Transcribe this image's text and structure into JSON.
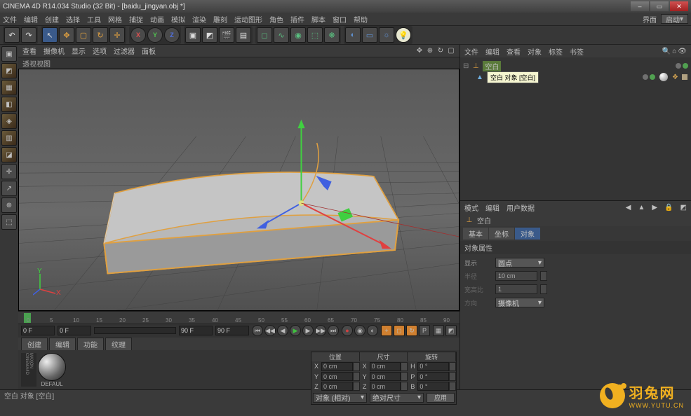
{
  "title": "CINEMA 4D R14.034 Studio (32 Bit) - [baidu_jingyan.obj *]",
  "menu": [
    "文件",
    "编辑",
    "创建",
    "选择",
    "工具",
    "网格",
    "捕捉",
    "动画",
    "模拟",
    "渲染",
    "雕刻",
    "运动图形",
    "角色",
    "插件",
    "脚本",
    "窗口",
    "帮助"
  ],
  "right_menu": {
    "label1": "界面",
    "layout_btn": "启动"
  },
  "toolbar_undo": [
    "↶",
    "↷"
  ],
  "toolbar_select": [
    "▦",
    "✥",
    "▢",
    "↻",
    "✛"
  ],
  "axis": [
    "X",
    "Y",
    "Z"
  ],
  "viewport_menu": [
    "查看",
    "摄像机",
    "显示",
    "选项",
    "过滤器",
    "面板"
  ],
  "viewport_sub": "透视视图",
  "left_icons": [
    "◩",
    "▦",
    "◧",
    "◈",
    "◩",
    "▥",
    "◪",
    "◊",
    "↗",
    "⊕",
    "⬚"
  ],
  "timeline": {
    "start": "0 F",
    "cur": "0 F",
    "end2": "90 F",
    "end": "90 F",
    "ticks": [
      0,
      5,
      10,
      15,
      20,
      25,
      30,
      35,
      40,
      45,
      50,
      55,
      60,
      65,
      70,
      75,
      80,
      85,
      90
    ]
  },
  "material_tabs": [
    "创建",
    "编辑",
    "功能",
    "纹理"
  ],
  "mat_default": "DEFAUL",
  "obj_header": [
    "文件",
    "编辑",
    "查看",
    "对象",
    "标签",
    "书签"
  ],
  "obj_tree": {
    "root": "空白",
    "child_tooltip": "空白 对象 [空白]"
  },
  "attr_header": [
    "模式",
    "编辑",
    "用户数据"
  ],
  "attr_title": "空白",
  "attr_tabs": [
    "基本",
    "坐标",
    "对象"
  ],
  "attr_section": "对象属性",
  "attr_fields": {
    "display_l": "显示",
    "display_v": "圆点",
    "radius_l": "半径",
    "radius_v": "10 cm",
    "aspect_l": "宽高比",
    "aspect_v": "1",
    "orient_l": "方向",
    "orient_v": "摄像机"
  },
  "coords": {
    "pos": "位置",
    "size": "尺寸",
    "rot": "旋转",
    "x": "X",
    "y": "Y",
    "z": "Z",
    "pv": "0 cm",
    "sv": "0 cm",
    "rv": "0 °",
    "mode1": "对象 (相对)",
    "mode2": "绝对尺寸",
    "apply": "应用"
  },
  "status": "空白 对象 [空白]",
  "brand": {
    "cn": "羽兔网",
    "url": "WWW.YUTU.CN"
  }
}
